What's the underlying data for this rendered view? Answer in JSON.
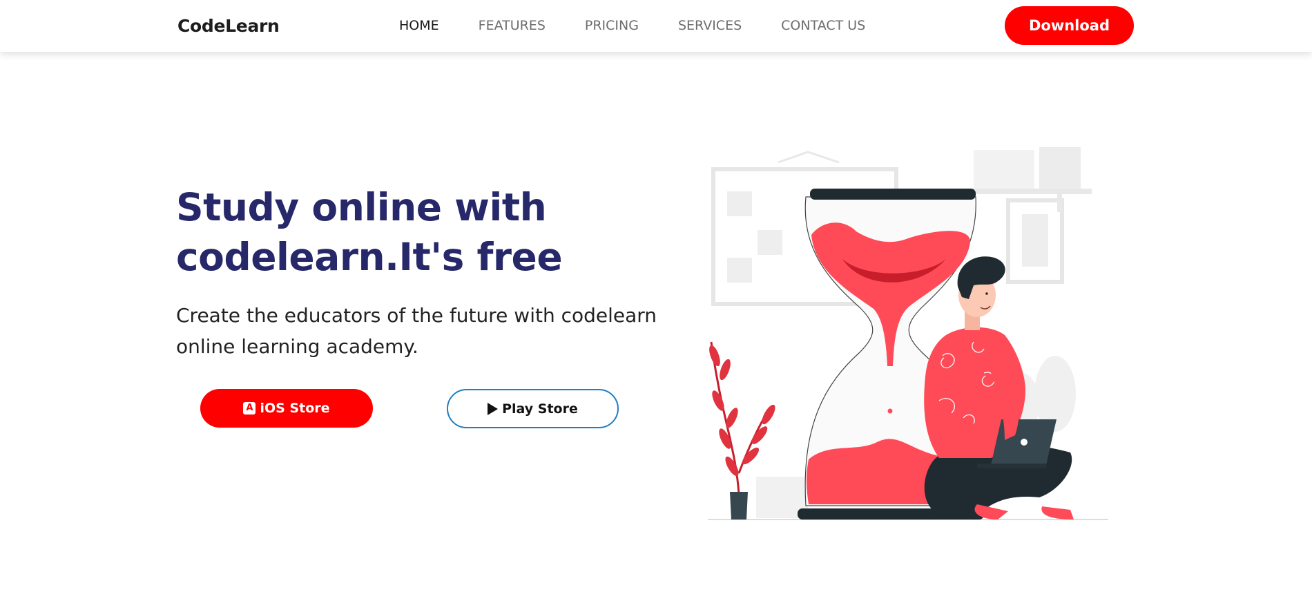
{
  "nav": {
    "brand": "CodeLearn",
    "links": [
      {
        "label": "HOME",
        "active": true
      },
      {
        "label": "FEATURES",
        "active": false
      },
      {
        "label": "PRICING",
        "active": false
      },
      {
        "label": "SERVICES",
        "active": false
      },
      {
        "label": "CONTACT US",
        "active": false
      }
    ],
    "download_label": "Download"
  },
  "hero": {
    "title_line1": "Study online with",
    "title_line2": "codelearn.It's free",
    "subtitle": "Create the educators of the future with codelearn online learning academy.",
    "ios_label": "iOS Store",
    "play_label": "Play Store"
  },
  "colors": {
    "accent": "#ff0000",
    "title": "#27286a",
    "outline": "#1f7fc1",
    "illustration_red": "#ff4a57",
    "illustration_dark": "#1f2b30"
  },
  "icons": {
    "ios": "app-store-icon",
    "play": "play-icon"
  }
}
